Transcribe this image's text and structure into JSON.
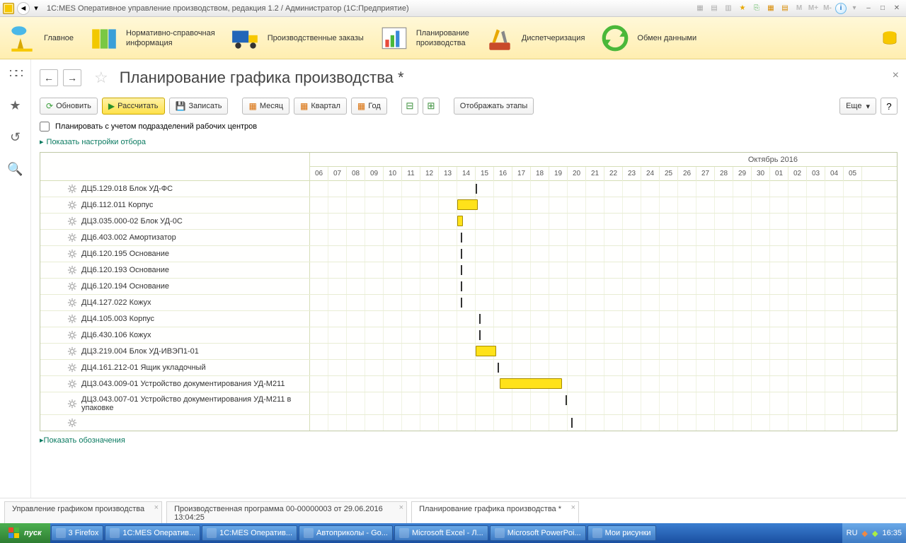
{
  "titlebar": {
    "title": "1C:MES Оперативное управление производством, редакция 1.2 / Администратор  (1С:Предприятие)",
    "m_buttons": [
      "M",
      "M+",
      "M-"
    ]
  },
  "ribbon": [
    {
      "label": "Главное"
    },
    {
      "label": "Нормативно-справочная\nинформация"
    },
    {
      "label": "Производственные заказы"
    },
    {
      "label": "Планирование\nпроизводства"
    },
    {
      "label": "Диспетчеризация"
    },
    {
      "label": "Обмен данными"
    }
  ],
  "page": {
    "title": "Планирование графика производства *",
    "toolbar": {
      "refresh": "Обновить",
      "calc": "Рассчитать",
      "save": "Записать",
      "month": "Месяц",
      "quarter": "Квартал",
      "year": "Год",
      "stages": "Отображать этапы",
      "more": "Еще",
      "help": "?"
    },
    "checkbox_label": "Планировать с учетом подразделений рабочих центров",
    "filter_link": "Показать настройки отбора",
    "legend_link": "Показать обозначения"
  },
  "gantt": {
    "month_label": "Октябрь 2016",
    "days": [
      "06",
      "07",
      "08",
      "09",
      "10",
      "11",
      "12",
      "13",
      "14",
      "15",
      "16",
      "17",
      "18",
      "19",
      "20",
      "21",
      "22",
      "23",
      "24",
      "25",
      "26",
      "27",
      "28",
      "29",
      "30",
      "01",
      "02",
      "03",
      "04",
      "05"
    ],
    "rows": [
      {
        "label": "ДЦ5.129.018 Блок УД-ФС",
        "tick": 9
      },
      {
        "label": "ДЦ6.112.011 Корпус",
        "bar": {
          "s": 8,
          "w": 1.1
        }
      },
      {
        "label": "ДЦ3.035.000-02 Блок УД-0С",
        "bar": {
          "s": 8,
          "w": 0.3
        }
      },
      {
        "label": "ДЦ6.403.002 Амортизатор",
        "tick": 8.2
      },
      {
        "label": "ДЦ6.120.195 Основание",
        "tick": 8.2
      },
      {
        "label": "ДЦ6.120.193 Основание",
        "tick": 8.2
      },
      {
        "label": "ДЦ6.120.194 Основание",
        "tick": 8.2
      },
      {
        "label": "ДЦ4.127.022 Кожух",
        "tick": 8.2
      },
      {
        "label": "ДЦ4.105.003 Корпус",
        "tick": 9.2
      },
      {
        "label": "ДЦ6.430.106 Кожух",
        "tick": 9.2
      },
      {
        "label": "ДЦ3.219.004 Блок УД-ИВЭП1-01",
        "bar": {
          "s": 9,
          "w": 1.1
        }
      },
      {
        "label": "ДЦ4.161.212-01 Ящик укладочный",
        "tick": 10.2
      },
      {
        "label": "ДЦ3.043.009-01 Устройство документирования УД-М211",
        "bar": {
          "s": 10.3,
          "w": 3.4
        }
      },
      {
        "label": "ДЦ3.043.007-01 Устройство документирования УД-М211 в упаковке",
        "tick": 13.9,
        "tall": true
      },
      {
        "label": "",
        "tick": 14.2
      }
    ]
  },
  "tabs": [
    {
      "label": "Управление графиком производства"
    },
    {
      "label": "Производственная программа 00-00000003 от 29.06.2016 13:04:25"
    },
    {
      "label": "Планирование графика производства *",
      "active": true
    }
  ],
  "taskbar": {
    "start": "пуск",
    "items": [
      "3 Firefox",
      "1C:MES Оператив...",
      "1C:MES Оператив...",
      "Автоприколы - Go...",
      "Microsoft Excel - Л...",
      "Microsoft PowerPoi...",
      "Мои рисунки"
    ],
    "lang": "RU",
    "time": "16:35"
  }
}
